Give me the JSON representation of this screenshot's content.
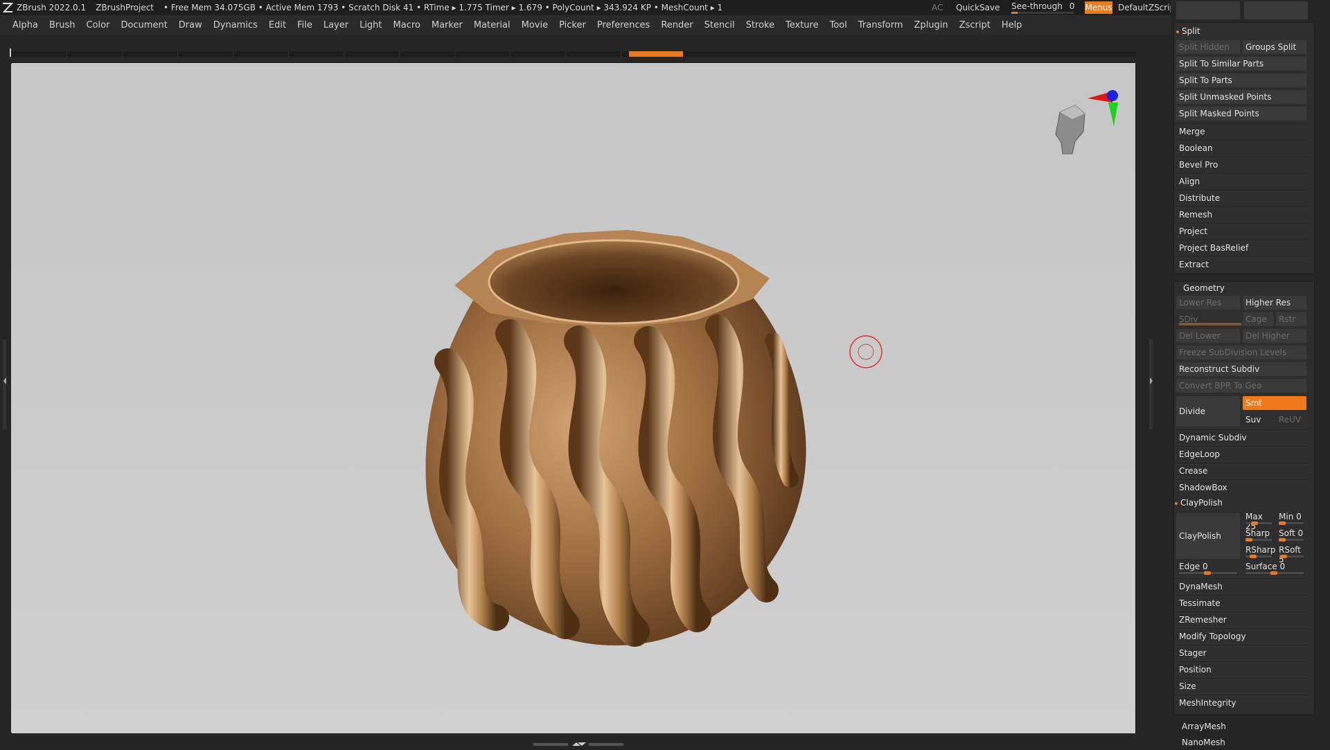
{
  "titlebar": {
    "app": "ZBrush 2022.0.1",
    "project": "ZBrushProject",
    "stats": "• Free Mem 34.075GB • Active Mem 1793 • Scratch Disk 41 •  RTime ▸ 1.775 Timer ▸ 1.679 • PolyCount ▸ 343.924 KP  • MeshCount ▸ 1",
    "ac": "AC",
    "quicksave": "QuickSave",
    "see_through_label": "See-through",
    "see_through_value": "0",
    "see_through_level": 0.1,
    "menus": "Menus",
    "script": "DefaultZScript",
    "accent": "#ee7a1b"
  },
  "menubar": [
    "Alpha",
    "Brush",
    "Color",
    "Document",
    "Draw",
    "Dynamics",
    "Edit",
    "File",
    "Layer",
    "Light",
    "Macro",
    "Marker",
    "Material",
    "Movie",
    "Picker",
    "Preferences",
    "Render",
    "Stencil",
    "Stroke",
    "Texture",
    "Tool",
    "Transform",
    "Zplugin",
    "Zscript",
    "Help"
  ],
  "panel": {
    "split": {
      "title": "Split",
      "split_hidden": "Split Hidden",
      "groups_split": "Groups Split",
      "similar": "Split To Similar Parts",
      "parts": "Split To Parts",
      "unmasked": "Split Unmasked Points",
      "masked": "Split Masked Points"
    },
    "subtool_items": [
      "Merge",
      "Boolean",
      "Bevel Pro",
      "Align",
      "Distribute",
      "Remesh",
      "Project",
      "Project BasRelief",
      "Extract"
    ],
    "geometry": {
      "title": "Geometry",
      "lower_res": "Lower Res",
      "higher_res": "Higher Res",
      "sdiv": "SDiv",
      "cage": "Cage",
      "rstr": "Rstr",
      "del_lower": "Del Lower",
      "del_higher": "Del Higher",
      "freeze": "Freeze SubDivision Levels",
      "reconstruct": "Reconstruct Subdiv",
      "convert_bpr": "Convert BPR To Geo",
      "divide": "Divide",
      "smt": "Smt",
      "suv": "Suv",
      "reuv": "ReUV"
    },
    "geometry_items": [
      "Dynamic Subdiv",
      "EdgeLoop",
      "Crease",
      "ShadowBox"
    ],
    "claypolish": {
      "title": "ClayPolish",
      "button": "ClayPolish",
      "max": "Max 25",
      "min": "Min 0",
      "sharp": "Sharp",
      "soft": "Soft 0",
      "rsharp": "RSharp",
      "rsoft": "RSoft 5",
      "edge": "Edge 0",
      "surface": "Surface 0"
    },
    "geometry_items2": [
      "DynaMesh",
      "Tessimate",
      "ZRemesher",
      "Modify Topology",
      "Stager",
      "Position",
      "Size",
      "MeshIntegrity"
    ],
    "bottom_items": [
      "ArrayMesh",
      "NanoMesh"
    ]
  }
}
